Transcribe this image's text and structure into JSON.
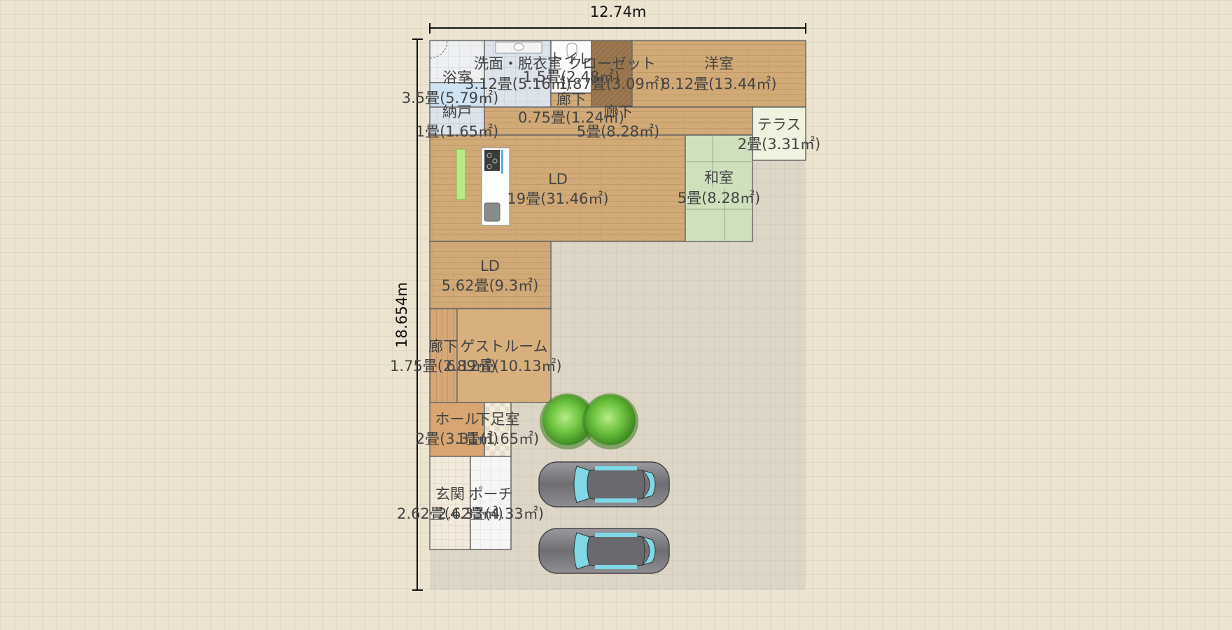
{
  "dimensions": {
    "width_label": "12.74m",
    "height_label": "18.654m"
  },
  "rooms": [
    {
      "id": "bath",
      "name": "浴室",
      "area": "3.5畳(5.79㎡)"
    },
    {
      "id": "wash",
      "name": "洗面・脱衣室",
      "area": "3.12畳(5.16㎡)"
    },
    {
      "id": "toilet",
      "name": "トイレ",
      "area": "1.5畳(2.48㎡)"
    },
    {
      "id": "closet",
      "name": "クローゼット",
      "area": "1.87畳(3.09㎡)"
    },
    {
      "id": "western",
      "name": "洋室",
      "area": "8.12畳(13.44㎡)"
    },
    {
      "id": "hall-small",
      "name": "廊下",
      "area": "0.75畳(1.24㎡)"
    },
    {
      "id": "storage",
      "name": "納戸",
      "area": "1畳(1.65㎡)"
    },
    {
      "id": "corridor",
      "name": "廊下",
      "area": "5畳(8.28㎡)"
    },
    {
      "id": "terrace",
      "name": "テラス",
      "area": "2畳(3.31㎡)"
    },
    {
      "id": "ld-main",
      "name": "LD",
      "area": "19畳(31.46㎡)"
    },
    {
      "id": "japanese",
      "name": "和室",
      "area": "5畳(8.28㎡)"
    },
    {
      "id": "ld-2",
      "name": "LD",
      "area": "5.62畳(9.3㎡)"
    },
    {
      "id": "hall-2",
      "name": "廊下",
      "area": "1.75畳(2.89㎡)"
    },
    {
      "id": "guest",
      "name": "ゲストルーム",
      "area": "6.12畳(10.13㎡)"
    },
    {
      "id": "entry-hall",
      "name": "ホール",
      "area": "2畳(3.31㎡)"
    },
    {
      "id": "shoe",
      "name": "下足室",
      "area": "1畳(1.65㎡)"
    },
    {
      "id": "genkan",
      "name": "玄関",
      "area": "2.62畳(4.33㎡)"
    },
    {
      "id": "porch",
      "name": "ポーチ",
      "area": "2.62畳(4.33㎡)"
    }
  ],
  "fixtures": [
    "tree-icon",
    "tree-icon",
    "car-icon",
    "car-icon",
    "kitchen-counter-icon",
    "stove-icon",
    "sink-icon"
  ]
}
